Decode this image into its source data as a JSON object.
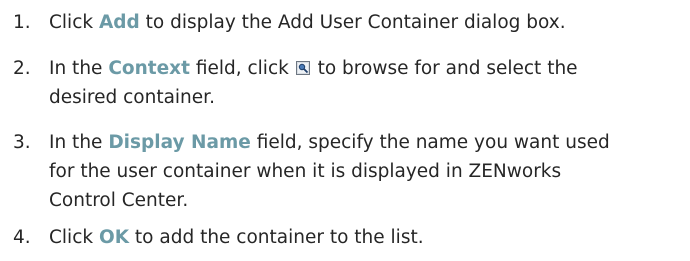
{
  "steps": [
    {
      "number": "1.",
      "before": "Click ",
      "ui_term": "Add",
      "after": " to display the Add User Container dialog box."
    },
    {
      "number": "2.",
      "before": "In the ",
      "ui_term": "Context",
      "middle": " field, click ",
      "icon": "browse-icon",
      "line1_tail": " to browse for and select the",
      "line2": "desired container."
    },
    {
      "number": "3.",
      "before": "In the ",
      "ui_term": "Display Name",
      "line1_tail": " field, specify the name you want used",
      "line2": "for the user container when it is displayed in ZENworks",
      "line3": "Control Center."
    },
    {
      "number": "4.",
      "before": "Click ",
      "ui_term": "OK",
      "after": " to add the container to the list."
    }
  ]
}
